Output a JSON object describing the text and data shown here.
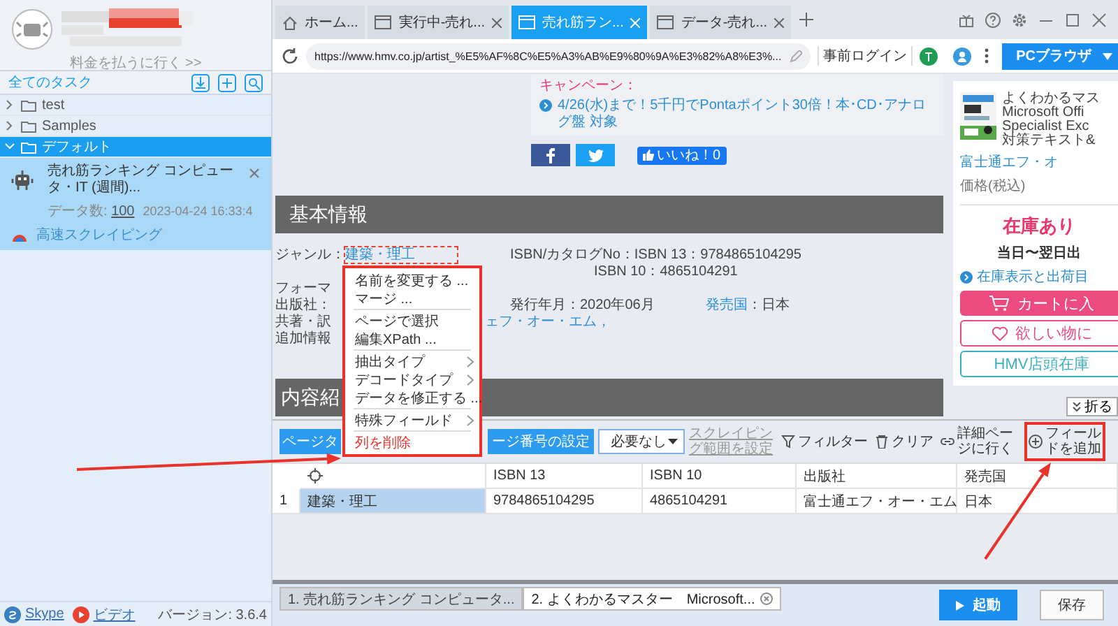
{
  "sidebar": {
    "payment_link": "料金を払うに行く >>",
    "section_title": "全てのタスク",
    "folders": [
      {
        "name": "test",
        "expanded": false,
        "selected": false
      },
      {
        "name": "Samples",
        "expanded": false,
        "selected": false
      },
      {
        "name": "デフォルト",
        "expanded": true,
        "selected": true,
        "children": [
          {
            "title": "売れ筋ランキング コンピュータ・IT (週間)...",
            "data_label": "データ数:",
            "data_count": "100",
            "timestamp": "2023-04-24 16:33:4",
            "mode": "高速スクレイピング",
            "selected": true
          }
        ]
      }
    ],
    "footer_links": [
      {
        "kind": "skype",
        "label": "Skype"
      },
      {
        "kind": "video",
        "label": "ビデオ"
      }
    ],
    "version": "バージョン: 3.6.4"
  },
  "browser_tabs": [
    {
      "kind": "home",
      "label": "ホーム...",
      "selected": false
    },
    {
      "kind": "page",
      "label": "実行中-売れ...",
      "selected": false
    },
    {
      "kind": "page",
      "label": "売れ筋ラン...",
      "selected": true
    },
    {
      "kind": "page",
      "label": "データ-売れ...",
      "selected": false
    }
  ],
  "address_bar": {
    "url": "https://www.hmv.co.jp/artist_%E5%AF%8C%E5%A3%AB%E9%80%9A%E3%82%A8%E3%...",
    "pre_login": "事前ログイン",
    "browser_mode": "PCブラウザ"
  },
  "web_page": {
    "campaign_title": "キャンペーン：",
    "campaign_link": "4/26(水)まで！5千円でPontaポイント30倍！本･CD･アナログ盤 対象",
    "like_button": "いいね！0",
    "basic_info_heading": "基本情報",
    "info": {
      "genre_label": "ジャンル：",
      "genre": "建築・理工",
      "isbn": "ISBN/カタログNo：ISBN 13：9784865104295",
      "isbn10": "ISBN 10：4865104291",
      "format_label": "フォーマ",
      "publisher_label": "出版社：",
      "release": "発行年月：2020年06月",
      "country_label": "発売国",
      "country": "：日本",
      "coauthor_label": "共著・訳",
      "coauthor_tail": "ェフ・オー・エム，",
      "extra_label": "追加情報"
    },
    "content_heading": "内容紹",
    "product": {
      "title_lines": [
        "よくわかるマス",
        "Microsoft Offi",
        "Specialist Exc",
        "対策テキスト&"
      ],
      "publisher": "富士通エフ・オ",
      "price_label": "価格(税込)",
      "stock": "在庫あり",
      "delivery": "当日〜翌日出",
      "stock_link": "在庫表示と出荷目",
      "cart_button": "カートに入",
      "wishlist_button": "欲しい物に",
      "store_button": "HMV店頭在庫"
    },
    "collapse_button": "折る"
  },
  "context_menu": {
    "highlighted": true,
    "items": [
      {
        "kind": "action",
        "label": "名前を変更する ..."
      },
      {
        "kind": "action",
        "label": "マージ ..."
      },
      {
        "kind": "separator"
      },
      {
        "kind": "action",
        "label": "ページで選択"
      },
      {
        "kind": "action",
        "label": "編集XPath ..."
      },
      {
        "kind": "separator"
      },
      {
        "kind": "submenu",
        "label": "抽出タイプ"
      },
      {
        "kind": "submenu",
        "label": "デコードタイプ"
      },
      {
        "kind": "action",
        "label": "データを修正する ..."
      },
      {
        "kind": "separator"
      },
      {
        "kind": "submenu",
        "label": "特殊フィールド"
      },
      {
        "kind": "separator"
      },
      {
        "kind": "danger",
        "label": "列を削除"
      }
    ]
  },
  "data_panel": {
    "page_button": "ページタ",
    "page_number_label": "ージ番号の設定",
    "page_select": "必要なし",
    "range_link": "スクレイピング範囲を設定",
    "tools": [
      {
        "kind": "filter",
        "label": "フィルター",
        "highlighted": false
      },
      {
        "kind": "clear",
        "label": "クリア",
        "highlighted": false
      },
      {
        "kind": "detail",
        "label": "詳細ページに行く",
        "highlighted": false
      },
      {
        "kind": "add",
        "label": "フィールドを追加",
        "highlighted": true
      }
    ],
    "columns": [
      {
        "kind": "locator"
      },
      {
        "kind": "text",
        "label": "ISBN 13"
      },
      {
        "kind": "text",
        "label": "ISBN 10"
      },
      {
        "kind": "text",
        "label": "出版社"
      },
      {
        "kind": "text",
        "label": "発売国"
      }
    ],
    "rows": [
      {
        "number": "1",
        "cells": [
          {
            "text": "建築・理工",
            "selected": true
          },
          {
            "text": "9784865104295",
            "selected": false
          },
          {
            "text": "4865104291",
            "selected": false
          },
          {
            "text": "富士通エフ・オー・エム",
            "selected": false
          },
          {
            "text": "日本",
            "selected": false
          }
        ]
      }
    ]
  },
  "bottom_bar": {
    "tabs": [
      {
        "label": "1. 売れ筋ランキング コンピュータ...",
        "selected": false
      },
      {
        "label": "2. よくわかるマスター　Microsoft...",
        "selected": true
      }
    ],
    "start_button": "起動",
    "save_button": "保存"
  }
}
